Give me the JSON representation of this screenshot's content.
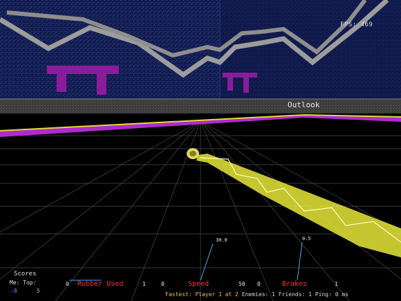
{
  "hud": {
    "fps_label": "FPS: 469",
    "zone_label": "Outlook",
    "wall_logo_text": "TT"
  },
  "scores": {
    "title": "Scores",
    "me_label": "Me:",
    "top_label": "Top:",
    "me_value": "-8",
    "top_value": "5"
  },
  "gauges": {
    "rubber": {
      "label": "Rubber Used",
      "min": "0",
      "max": "1",
      "value_text": "",
      "level": 0
    },
    "speed": {
      "label": "Speed",
      "min": "0",
      "max": "50",
      "value_text": "30.0",
      "level": 0.6
    },
    "brakes": {
      "label": "Brakes",
      "min": "0",
      "max": "1",
      "value_text": "0.5",
      "level": 0.5
    }
  },
  "status_bar": {
    "fastest_label": "Fastest: Player 1 at 2",
    "enemies_label": "Enemies: 1",
    "friends_label": "Friends: 1",
    "ping_label": "Ping: 0 ms"
  },
  "colors": {
    "wall": "#101a4c",
    "logo": "#8a1c9c",
    "trail": "#e0e030",
    "rim": "#b02ad0",
    "grid": "#555555",
    "gauge_label": "#ff3030",
    "player_score": "#4aa8ff",
    "top_score": "#e8c040"
  }
}
